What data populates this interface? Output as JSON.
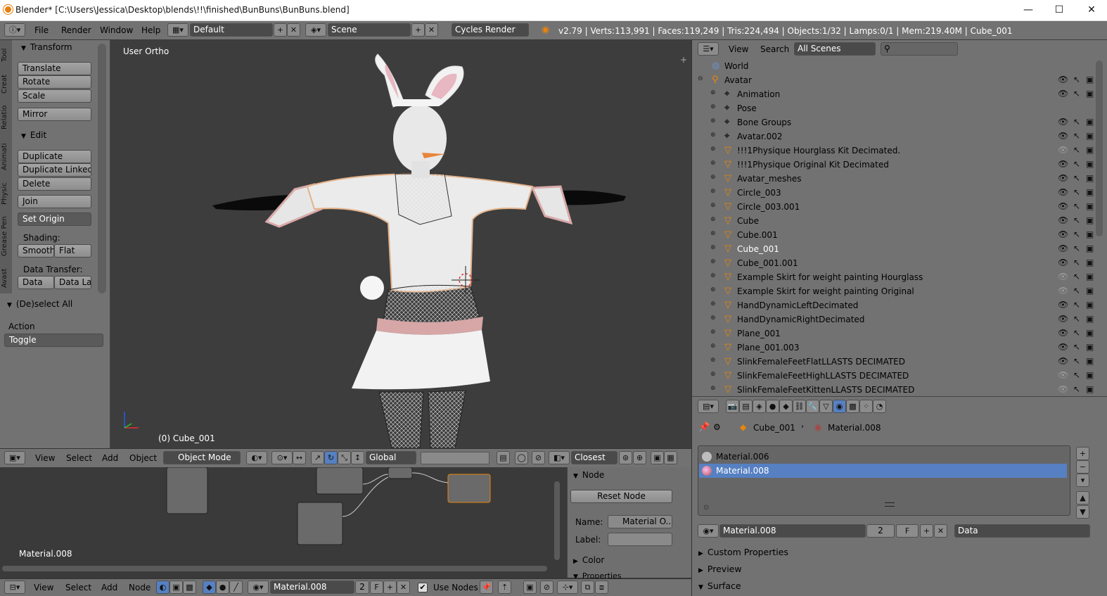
{
  "titlebar": {
    "title": "Blender* [C:\\Users\\Jessica\\Desktop\\blends\\!!\\finished\\BunBuns\\BunBuns.blend]",
    "min": "—",
    "max": "☐",
    "close": "✕"
  },
  "info": {
    "menus": [
      "File",
      "Render",
      "Window",
      "Help"
    ],
    "layout": "Default",
    "scene": "Scene",
    "engine": "Cycles Render",
    "stats": "v2.79 | Verts:113,991 | Faces:119,249 | Tris:224,494 | Objects:1/32 | Lamps:0/1 | Mem:219.40M | Cube_001"
  },
  "tabs": [
    "Tool",
    "Creat",
    "Relatio",
    "Animati",
    "Physic",
    "Grease Pen",
    "Avast"
  ],
  "toolshelf": {
    "transform": "Transform",
    "translate": "Translate",
    "rotate": "Rotate",
    "scale": "Scale",
    "mirror": "Mirror",
    "edit": "Edit",
    "duplicate": "Duplicate",
    "duplicate_linked": "Duplicate Linked",
    "delete": "Delete",
    "join": "Join",
    "set_origin": "Set Origin",
    "shading": "Shading:",
    "smooth": "Smooth",
    "flat": "Flat",
    "data_transfer": "Data Transfer:",
    "data": "Data",
    "data_la": "Data La",
    "deselect_all": "(De)select All",
    "action": "Action",
    "toggle": "Toggle"
  },
  "viewport": {
    "label": "User Ortho",
    "object": "(0) Cube_001"
  },
  "vp_header": {
    "menus": [
      "View",
      "Select",
      "Add",
      "Object"
    ],
    "mode": "Object Mode",
    "orientation": "Global",
    "snap": "Closest"
  },
  "node_editor": {
    "material": "Material.008"
  },
  "node_panel": {
    "node": "Node",
    "reset": "Reset Node",
    "name_label": "Name:",
    "name_value": "Material O...",
    "label_label": "Label:",
    "color": "Color",
    "properties": "Properties"
  },
  "node_header": {
    "menus": [
      "View",
      "Select",
      "Add",
      "Node"
    ],
    "material": "Material.008",
    "users": "2",
    "fake": "F",
    "use_nodes": "Use Nodes"
  },
  "outliner": {
    "view": "View",
    "search": "Search",
    "filter": "All Scenes",
    "rows": [
      {
        "name": "World",
        "indent": 0
      },
      {
        "name": "Avatar",
        "indent": 0
      },
      {
        "name": "Animation",
        "indent": 1
      },
      {
        "name": "Pose",
        "indent": 1
      },
      {
        "name": "Bone Groups",
        "indent": 1
      },
      {
        "name": "Avatar.002",
        "indent": 1
      },
      {
        "name": "!!!1Physique Hourglass Kit Decimated.",
        "indent": 1
      },
      {
        "name": "!!!1Physique Original Kit Decimated",
        "indent": 1
      },
      {
        "name": "Avatar_meshes",
        "indent": 1
      },
      {
        "name": "Circle_003",
        "indent": 1
      },
      {
        "name": "Circle_003.001",
        "indent": 1
      },
      {
        "name": "Cube",
        "indent": 1
      },
      {
        "name": "Cube.001",
        "indent": 1
      },
      {
        "name": "Cube_001",
        "indent": 1
      },
      {
        "name": "Cube_001.001",
        "indent": 1
      },
      {
        "name": "Example Skirt for weight painting Hourglass",
        "indent": 1
      },
      {
        "name": "Example Skirt for weight painting Original",
        "indent": 1
      },
      {
        "name": "HandDynamicLeftDecimated",
        "indent": 1
      },
      {
        "name": "HandDynamicRightDecimated",
        "indent": 1
      },
      {
        "name": "Plane_001",
        "indent": 1
      },
      {
        "name": "Plane_001.003",
        "indent": 1
      },
      {
        "name": "SlinkFemaleFeetFlatLLASTS DECIMATED",
        "indent": 1
      },
      {
        "name": "SlinkFemaleFeetHighLLASTS DECIMATED",
        "indent": 1
      },
      {
        "name": "SlinkFemaleFeetKittenLLASTS DECIMATED",
        "indent": 1
      }
    ]
  },
  "properties": {
    "object": "Cube_001",
    "material": "Material.008",
    "slots": [
      "Material.006",
      "Material.008"
    ],
    "mat_field": "Material.008",
    "users": "2",
    "fake": "F",
    "link": "Data",
    "sections": [
      "Custom Properties",
      "Preview",
      "Surface"
    ]
  }
}
